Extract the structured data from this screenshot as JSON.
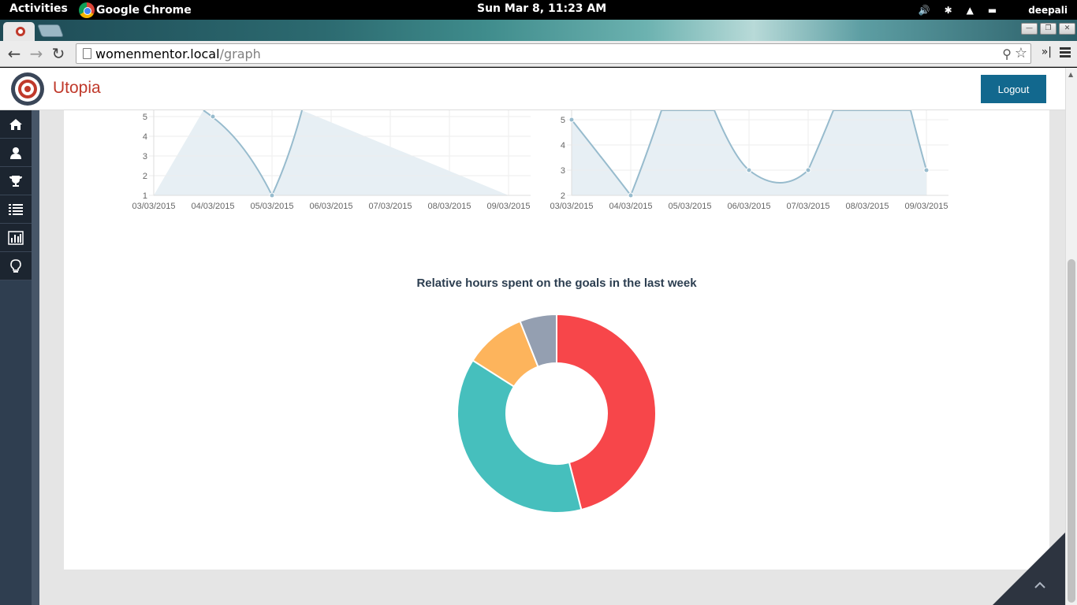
{
  "os": {
    "activities_label": "Activities",
    "app_name": "Google Chrome",
    "clock": "Sun Mar  8, 11:23 AM",
    "user": "deepali"
  },
  "browser": {
    "url_host": "womenmentor.local",
    "url_path": "/graph"
  },
  "navbar": {
    "brand": "Utopia",
    "logout_label": "Logout"
  },
  "sidebar": {
    "items": [
      {
        "icon": "home-icon"
      },
      {
        "icon": "user-icon"
      },
      {
        "icon": "trophy-icon"
      },
      {
        "icon": "list-icon"
      },
      {
        "icon": "bar-chart-icon"
      },
      {
        "icon": "lightbulb-icon"
      }
    ]
  },
  "donut_title": "Relative hours spent on the goals in the last week",
  "colors": {
    "line": "#97bbcd",
    "fill": "#e7eff4",
    "red": "#f7464a",
    "teal": "#46bfbd",
    "yellow": "#fdb45c",
    "gray": "#949fb1"
  },
  "chart_data": [
    {
      "type": "line",
      "x": [
        "03/03/2015",
        "04/03/2015",
        "05/03/2015",
        "06/03/2015",
        "07/03/2015",
        "08/03/2015",
        "09/03/2015"
      ],
      "ytick_labels": [
        "1",
        "2",
        "3",
        "4",
        "5"
      ],
      "visible_points": [
        {
          "x": "04/03/2015",
          "y": 5
        },
        {
          "x": "05/03/2015",
          "y": 1
        }
      ],
      "grid": true
    },
    {
      "type": "line",
      "x": [
        "03/03/2015",
        "04/03/2015",
        "05/03/2015",
        "06/03/2015",
        "07/03/2015",
        "08/03/2015",
        "09/03/2015"
      ],
      "ytick_labels": [
        "2",
        "3",
        "4",
        "5"
      ],
      "visible_points": [
        {
          "x": "03/03/2015",
          "y": 5
        },
        {
          "x": "04/03/2015",
          "y": 2
        },
        {
          "x": "06/03/2015",
          "y": 3
        },
        {
          "x": "07/03/2015",
          "y": 3
        },
        {
          "x": "09/03/2015",
          "y": 3
        }
      ],
      "grid": true
    },
    {
      "type": "pie",
      "title": "Relative hours spent on the goals in the last week",
      "values": [
        46,
        38,
        10,
        6
      ],
      "colors": [
        "#f7464a",
        "#46bfbd",
        "#fdb45c",
        "#949fb1"
      ]
    }
  ]
}
